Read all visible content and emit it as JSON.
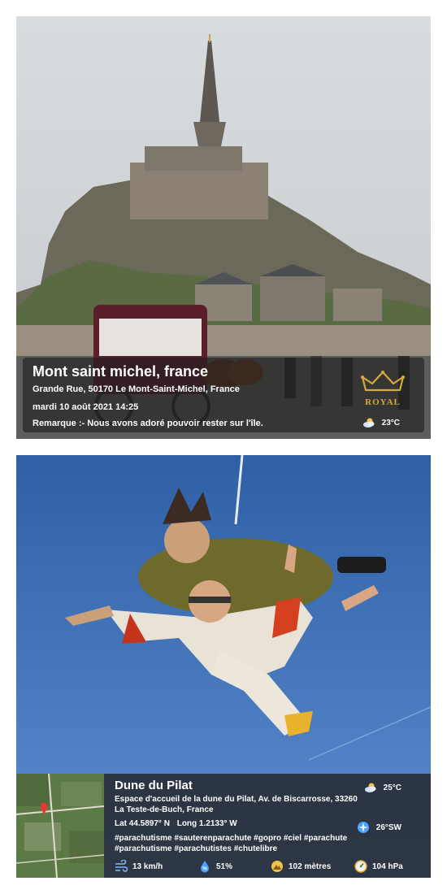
{
  "posts": [
    {
      "title": "Mont saint michel, france",
      "address": "Grande Rue, 50170 Le Mont-Saint-Michel, France",
      "datetime": "mardi 10 août 2021 14:25",
      "note": "Remarque :- Nous avons adoré pouvoir rester sur l'île.",
      "temperature": "23°C",
      "weather_icon": "partly-cloudy-icon",
      "logo_text": "ROYAL"
    },
    {
      "title": "Dune du Pilat",
      "address": "Espace d'accueil de la dune du Pilat, Av. de Biscarrosse, 33260 La Teste-de-Buch, France",
      "lat": "Lat 44.5897° N",
      "long": "Long 1.2133° W",
      "tags": "#parachutisme #sauterenparachute #gopro #ciel #parachute #parachutisme #parachutistes #chutelibre",
      "temperature": "25°C",
      "wind_direction": "26°SW",
      "wind_speed": "13 km/h",
      "humidity": "51%",
      "altitude": "102 mètres",
      "pressure": "104 hPa"
    }
  ],
  "colors": {
    "accent": "#4aa3ff",
    "gold": "#d4a93a"
  }
}
